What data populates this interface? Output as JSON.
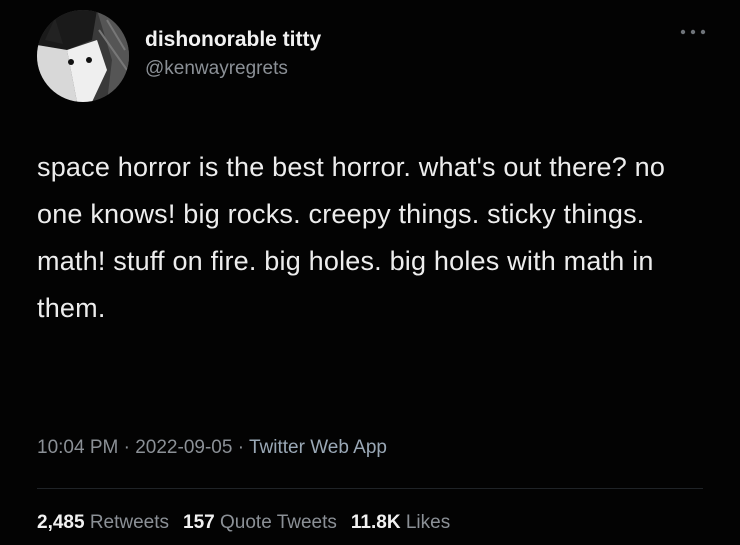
{
  "author": {
    "display_name": "dishonorable titty",
    "handle": "@kenwayregrets",
    "avatar_icon": "cat-avatar"
  },
  "more_icon": "more-options-icon",
  "tweet": {
    "text": "space horror is the best horror. what's out there? no one knows! big rocks. creepy things. sticky things. math! stuff on fire. big holes. big holes with math in them.",
    "time": "10:04 PM",
    "separator1": " · ",
    "date": "2022-09-05",
    "separator2": " · ",
    "source": "Twitter Web App"
  },
  "stats": {
    "retweets_count": "2,485",
    "retweets_label": "Retweets",
    "quotes_count": "157",
    "quotes_label": "Quote Tweets",
    "likes_count": "11.8K",
    "likes_label": "Likes"
  },
  "colors": {
    "background": "#030303",
    "text": "#ededed",
    "secondary": "#8b9096"
  }
}
